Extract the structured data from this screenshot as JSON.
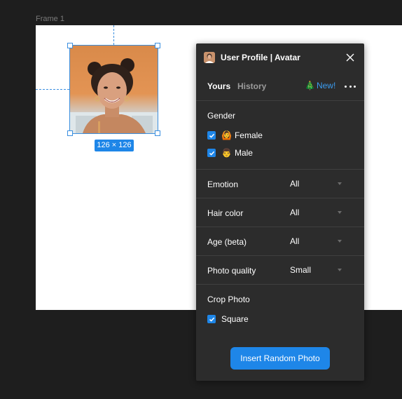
{
  "canvas": {
    "frame_label": "Frame 1",
    "selection_size": "126 × 126"
  },
  "panel": {
    "title": "User Profile | Avatar",
    "tabs": [
      "Yours",
      "History"
    ],
    "new_label": "New!",
    "gender": {
      "title": "Gender",
      "options": [
        {
          "label": "Female",
          "emoji": "🙆",
          "checked": true
        },
        {
          "label": "Male",
          "emoji": "👨",
          "checked": true
        }
      ]
    },
    "filters": [
      {
        "label": "Emotion",
        "value": "All"
      },
      {
        "label": "Hair color",
        "value": "All"
      },
      {
        "label": "Age (beta)",
        "value": "All"
      },
      {
        "label": "Photo quality",
        "value": "Small"
      }
    ],
    "crop": {
      "title": "Crop Photo",
      "option": {
        "label": "Square",
        "checked": true
      }
    },
    "insert_button": "Insert Random Photo"
  },
  "colors": {
    "accent": "#1e86e8",
    "panel_bg": "#2c2c2c",
    "canvas_bg": "#1e1e1e",
    "link": "#3b9cf0"
  }
}
